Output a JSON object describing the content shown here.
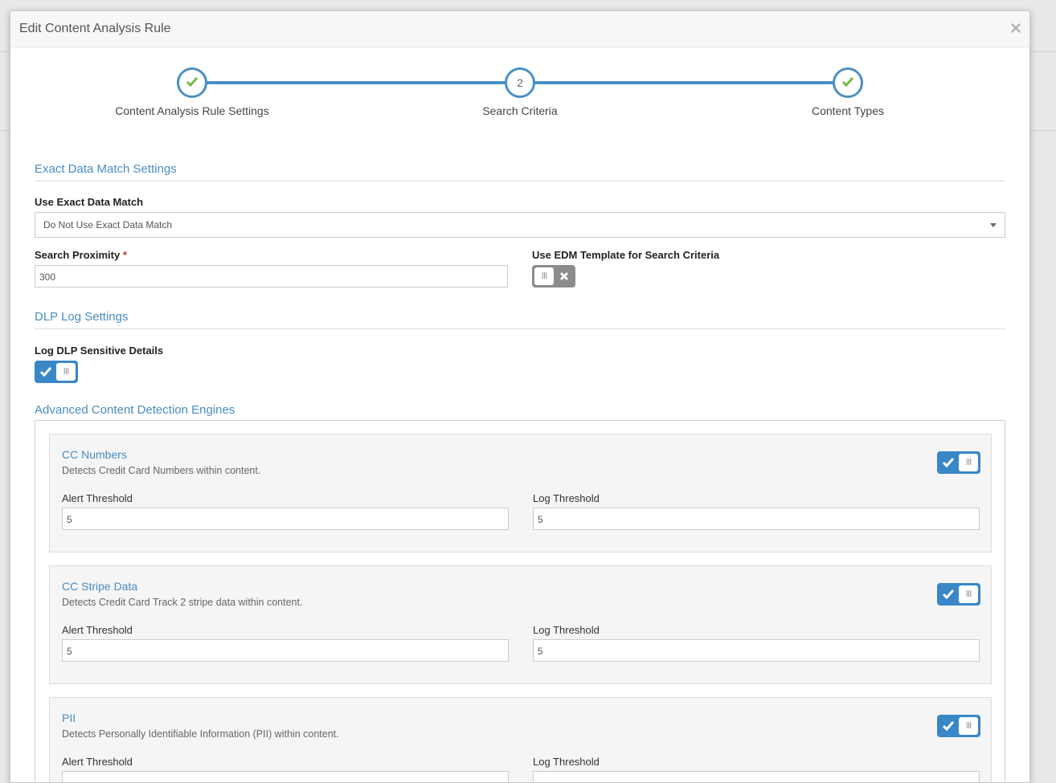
{
  "modal": {
    "title": "Edit Content Analysis Rule",
    "close_label": "×"
  },
  "stepper": {
    "steps": [
      {
        "label": "Content Analysis Rule Settings",
        "state": "complete",
        "number": ""
      },
      {
        "label": "Search Criteria",
        "state": "current",
        "number": "2"
      },
      {
        "label": "Content Types",
        "state": "complete",
        "number": ""
      }
    ]
  },
  "edm": {
    "section_title": "Exact Data Match Settings",
    "use_edm_label": "Use Exact Data Match",
    "use_edm_value": "Do Not Use Exact Data Match",
    "proximity_label": "Search Proximity",
    "proximity_required": "*",
    "proximity_value": "300",
    "template_label": "Use EDM Template for Search Criteria",
    "template_enabled": false
  },
  "dlp": {
    "section_title": "DLP Log Settings",
    "log_label": "Log DLP Sensitive Details",
    "log_enabled": true
  },
  "engines": {
    "section_title": "Advanced Content Detection Engines",
    "alert_label": "Alert Threshold",
    "log_label": "Log Threshold",
    "items": [
      {
        "title": "CC Numbers",
        "desc": "Detects Credit Card Numbers within content.",
        "alert": "5",
        "log": "5",
        "enabled": true
      },
      {
        "title": "CC Stripe Data",
        "desc": "Detects Credit Card Track 2 stripe data within content.",
        "alert": "5",
        "log": "5",
        "enabled": true
      },
      {
        "title": "PII",
        "desc": "Detects Personally Identifiable Information (PII) within content.",
        "alert": "",
        "log": "",
        "enabled": true
      }
    ]
  },
  "colors": {
    "accent": "#4a90c2",
    "check_green": "#7ab648",
    "toggle_on": "#3a87c8",
    "toggle_off": "#8c8c8c"
  }
}
